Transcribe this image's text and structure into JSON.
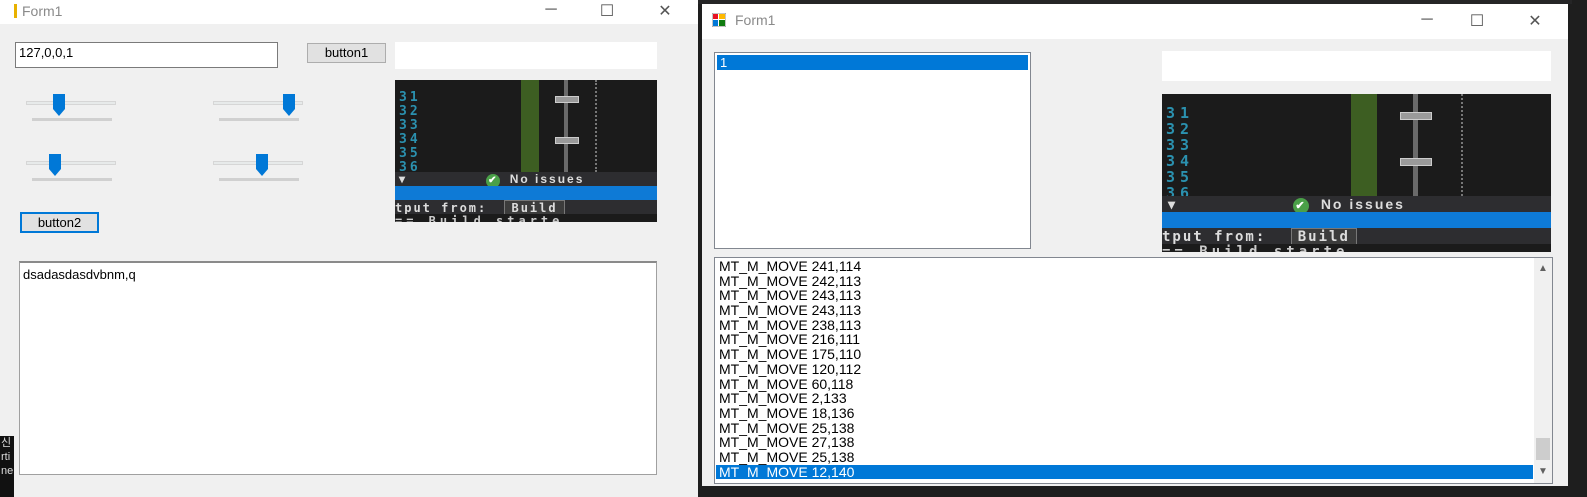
{
  "window1": {
    "title": "Form1",
    "controls": {
      "minimize": "─",
      "maximize": "☐",
      "close": "✕"
    },
    "ip_input": {
      "value": "127,0,0,1"
    },
    "button1": {
      "label": "button1"
    },
    "button2": {
      "label": "button2"
    },
    "sliders": [
      0.35,
      0.9,
      0.3,
      0.55
    ],
    "textarea": {
      "value": "dsadasdasdvbnm,q"
    }
  },
  "window2": {
    "title": "Form1",
    "controls": {
      "minimize": "─",
      "maximize": "☐",
      "close": "✕"
    },
    "listbox": {
      "items": [
        "1"
      ],
      "selected_index": 0
    },
    "log": {
      "rows": [
        "MT_M_MOVE 241,114",
        "MT_M_MOVE 242,113",
        "MT_M_MOVE 243,113",
        "MT_M_MOVE 243,113",
        "MT_M_MOVE 238,113",
        "MT_M_MOVE 216,111",
        "MT_M_MOVE 175,110",
        "MT_M_MOVE 120,112",
        "MT_M_MOVE 60,118",
        "MT_M_MOVE 2,133",
        "MT_M_MOVE 18,136",
        "MT_M_MOVE 25,138",
        "MT_M_MOVE 27,138",
        "MT_M_MOVE 25,138",
        "MT_M_MOVE 12,140"
      ],
      "selected_index": 14,
      "scroll_up_arrow": "▲",
      "scroll_down_arrow": "▼"
    }
  },
  "captured_image": {
    "line_numbers": [
      "31",
      "32",
      "33",
      "34",
      "35",
      "36"
    ],
    "status_text": "No issues",
    "check_glyph": "✔",
    "dropdown_glyph": "▾",
    "output_label": "tput from:",
    "output_box": "Build",
    "bottom_text": "== Build starte"
  },
  "background_edge_text": [
    "신",
    "rti",
    "ne"
  ],
  "colors": {
    "accent": "#0078d7",
    "window_bg": "#f0f0f0",
    "code_num": "#2b91af",
    "ok_green": "#4aa048"
  }
}
